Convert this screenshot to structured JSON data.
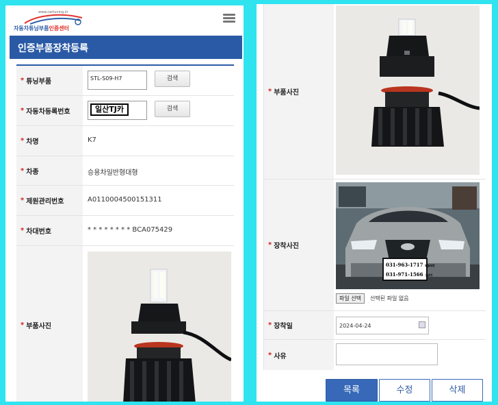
{
  "left_screen": {
    "logo": {
      "url": "www.cartuning.kr",
      "brand_name": "자동차튜닝부품",
      "brand_accent": "인증센터"
    },
    "menu_icon": "hamburger-menu-icon",
    "page_title": "인증부품장착등록",
    "fields": {
      "tuning_part": {
        "label": "튜닝부품",
        "value": "STL-S09-H7",
        "button": "검색"
      },
      "vehicle_reg": {
        "label": "자동차등록번호",
        "value": "일산TJ카",
        "button": "검색"
      },
      "car_name": {
        "label": "차명",
        "value": "K7"
      },
      "car_type": {
        "label": "차종",
        "value": "승용차일반형대형"
      },
      "spec_number": {
        "label": "제원관리번호",
        "value": "A0110004500151311"
      },
      "vin": {
        "label": "차대번호",
        "value": "* * * * * * * * BCA075429"
      },
      "part_photo": {
        "label": "부품사진"
      }
    }
  },
  "right_screen": {
    "part_photo": {
      "label": "부품사진"
    },
    "install_photo": {
      "label": "장착사진",
      "sign_line1": "031-963-1717",
      "sign_line1_note": "부일보안",
      "sign_line2": "031-971-1566",
      "sign_line2_note": "그냥이",
      "file_button": "파일 선택",
      "file_status": "선택된 파일 없음"
    },
    "install_date": {
      "label": "장착일",
      "value": "2024-04-24"
    },
    "reason": {
      "label": "사유",
      "value": ""
    },
    "actions": {
      "list": "목록",
      "edit": "수정",
      "delete": "삭제"
    }
  },
  "colors": {
    "background": "#2fe3ef",
    "title_bar": "#2a5aa6",
    "required_star": "#d02020",
    "primary_button": "#3769b8"
  }
}
